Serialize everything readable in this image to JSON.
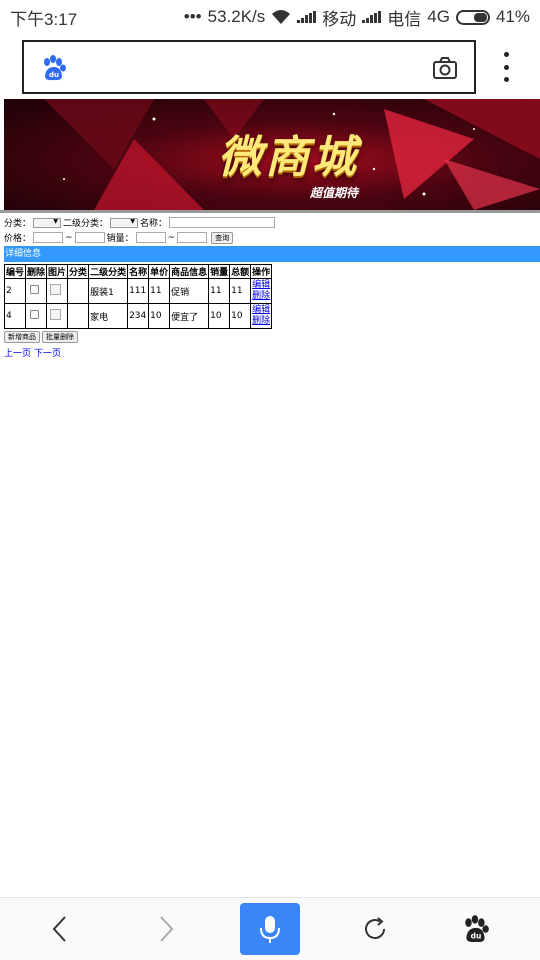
{
  "status": {
    "time": "下午3:17",
    "dots": "•••",
    "speed": "53.2K/s",
    "carrier1": "移动",
    "carrier2": "电信",
    "network": "4G",
    "battery": "41%"
  },
  "search": {
    "placeholder": ""
  },
  "banner": {
    "title": "微商城",
    "subtitle": "超值期待"
  },
  "filters": {
    "category_label": "分类：",
    "subcategory_label": "二级分类：",
    "name_label": "名称：",
    "price_label": "价格：",
    "sales_label": "销量：",
    "range_sep": "~",
    "query_button": "查询"
  },
  "detail_header": "详细信息",
  "table": {
    "headers": [
      "编号",
      "删除",
      "图片",
      "分类",
      "二级分类",
      "名称",
      "单价",
      "商品信息",
      "销量",
      "总额",
      "操作"
    ],
    "rows": [
      {
        "id": "2",
        "category": "",
        "subcategory": "服装1",
        "name": "111",
        "price": "11",
        "info": "促销",
        "sales": "11",
        "total": "11",
        "edit": "编辑",
        "delete": "删除"
      },
      {
        "id": "4",
        "category": "",
        "subcategory": "家电",
        "name": "234",
        "price": "10",
        "info": "便宜了",
        "sales": "10",
        "total": "10",
        "edit": "编辑",
        "delete": "删除"
      }
    ]
  },
  "actions": {
    "add": "新增商品",
    "batch_delete": "批量删除"
  },
  "pager": {
    "prev": "上一页",
    "next": "下一页"
  },
  "colors": {
    "accent": "#3399ff",
    "nav_mic": "#3a86f7",
    "link": "#0000ee"
  }
}
